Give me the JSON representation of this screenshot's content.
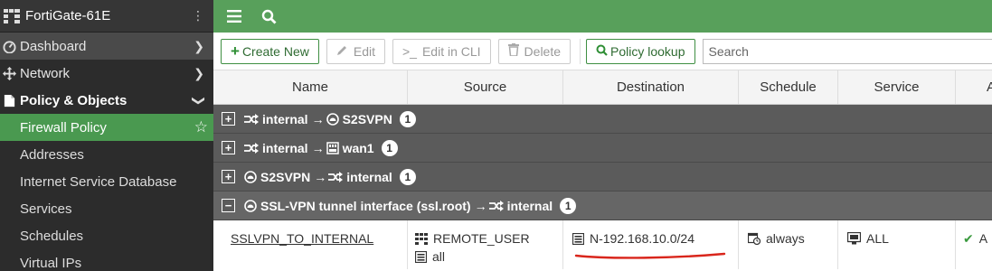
{
  "sidebar": {
    "device_name": "FortiGate-61E",
    "nav": [
      {
        "label": "Dashboard",
        "icon": "dashboard-icon"
      },
      {
        "label": "Network",
        "icon": "network-icon"
      },
      {
        "label": "Policy & Objects",
        "icon": "policy-icon"
      }
    ],
    "subnav": [
      {
        "label": "Firewall Policy",
        "active": true
      },
      {
        "label": "Addresses"
      },
      {
        "label": "Internet Service Database"
      },
      {
        "label": "Services"
      },
      {
        "label": "Schedules"
      },
      {
        "label": "Virtual IPs"
      }
    ]
  },
  "toolbar": {
    "create_new": "Create New",
    "edit": "Edit",
    "edit_cli": "Edit in CLI",
    "delete": "Delete",
    "policy_lookup": "Policy lookup",
    "search_placeholder": "Search"
  },
  "table": {
    "columns": [
      "Name",
      "Source",
      "Destination",
      "Schedule",
      "Service",
      "A"
    ],
    "groups": [
      {
        "from": "internal",
        "arrow": "→",
        "to": "S2SVPN",
        "count": "1"
      },
      {
        "from": "internal",
        "arrow": "→",
        "to": "wan1",
        "count": "1"
      },
      {
        "from": "S2SVPN",
        "arrow": "→",
        "to": "internal",
        "count": "1"
      },
      {
        "from": "SSL-VPN tunnel interface (ssl.root)",
        "arrow": "→",
        "to": "internal",
        "count": "1"
      }
    ],
    "row": {
      "name": "SSLVPN_TO_INTERNAL",
      "source": [
        "REMOTE_USER",
        "all"
      ],
      "destination": "N-192.168.10.0/24",
      "schedule": "always",
      "service": "ALL",
      "action": "A"
    }
  },
  "colors": {
    "brand_green": "#58a05b",
    "active_green": "#4a9950",
    "sidebar_bg": "#2c2c2c",
    "group_bg": "#5b5b5b",
    "annotation_red": "#d9261c"
  }
}
